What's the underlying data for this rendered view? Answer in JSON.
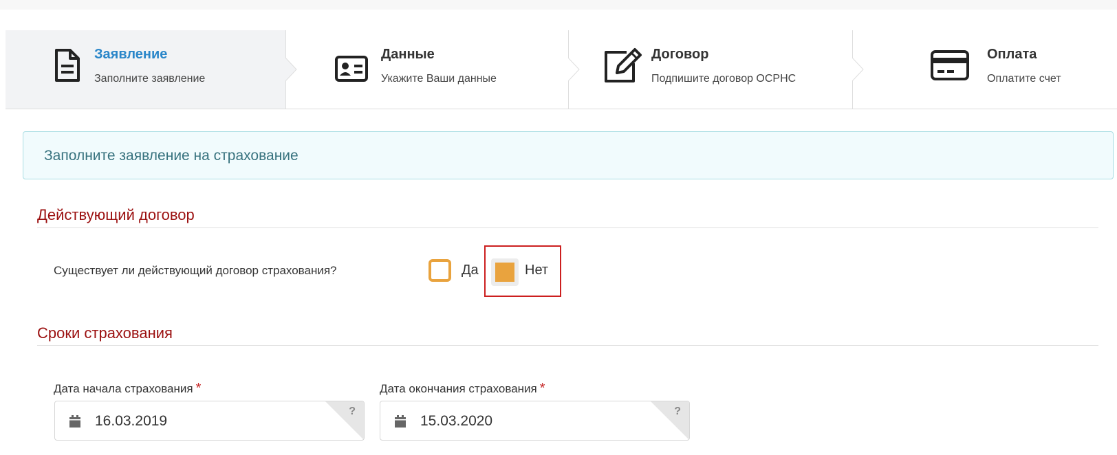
{
  "wizard": {
    "steps": [
      {
        "title": "Заявление",
        "subtitle": "Заполните заявление",
        "icon": "document-icon",
        "active": true
      },
      {
        "title": "Данные",
        "subtitle": "Укажите Ваши данные",
        "icon": "id-card-icon",
        "active": false
      },
      {
        "title": "Договор",
        "subtitle": "Подпишите договор ОСРНС",
        "icon": "edit-icon",
        "active": false
      },
      {
        "title": "Оплата",
        "subtitle": "Оплатите счет",
        "icon": "credit-card-icon",
        "active": false
      }
    ]
  },
  "info": {
    "text": "Заполните заявление на страхование"
  },
  "contract_section": {
    "title": "Действующий договор",
    "question": "Существует ли действующий договор страхования?",
    "options": [
      {
        "label": "Да",
        "checked": false
      },
      {
        "label": "Нет",
        "checked": true
      }
    ]
  },
  "terms_section": {
    "title": "Сроки страхования",
    "start": {
      "label": "Дата начала страхования",
      "value": "16.03.2019",
      "required_mark": "*",
      "help": "?"
    },
    "end": {
      "label": "Дата окончания страхования",
      "value": "15.03.2020",
      "required_mark": "*",
      "help": "?"
    }
  },
  "colors": {
    "accent_checkbox": "#e9a33e",
    "active_step_title": "#2a86c9",
    "section_title": "#9b1010",
    "highlight_border": "#cc1f1f",
    "info_text": "#37727e"
  }
}
